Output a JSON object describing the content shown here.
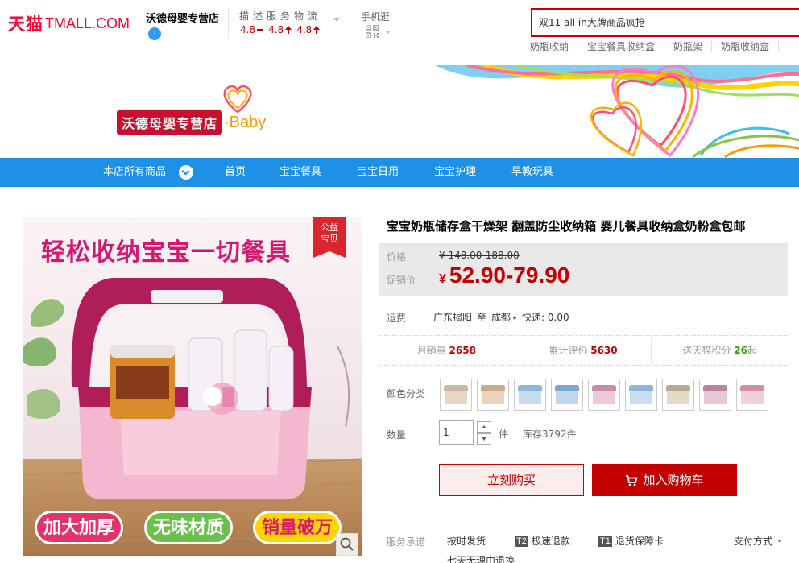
{
  "header": {
    "logo_cn": "天猫",
    "logo_en": "TMALL.COM",
    "shop_name": "沃德母婴专营店",
    "shop_badge": "1",
    "rating_title": "描述服务物流",
    "scores": [
      {
        "value": "4.8",
        "trend": "flat"
      },
      {
        "value": "4.8",
        "trend": "up"
      },
      {
        "value": "4.8",
        "trend": "up"
      }
    ],
    "mobile_label": "手机逛",
    "search_value": "双11 all in大牌商品疯抢",
    "hotwords": [
      "奶瓶收纳",
      "宝宝餐具收纳盒",
      "奶瓶架",
      "奶瓶收纳盒"
    ]
  },
  "banner": {
    "shop_logo_cn": "沃德母婴专营店",
    "shop_logo_en": "·Baby"
  },
  "nav": {
    "items": [
      "本店所有商品",
      "首页",
      "宝宝餐具",
      "宝宝日用",
      "宝宝护理",
      "早教玩具"
    ]
  },
  "gallery": {
    "headline": "轻松收纳宝宝一切餐具",
    "badge_line1": "公益",
    "badge_line2": "宝贝",
    "pills": [
      "加大加厚",
      "无味材质",
      "销量破万"
    ]
  },
  "product": {
    "title": "宝宝奶瓶储存盒干燥架 翻盖防尘收纳箱 婴儿餐具收纳盒奶粉盒包邮",
    "price_label": "价格",
    "original_price": "¥ 148.00-188.00",
    "promo_label": "促销价",
    "promo_currency": "¥",
    "promo_price": "52.90-79.90",
    "shipping_label": "运费",
    "ship_from": "广东揭阳",
    "ship_to_prefix": "至",
    "ship_to": "成都",
    "express": "快递: 0.00",
    "stats": {
      "monthly_sales_label": "月销量",
      "monthly_sales": "2658",
      "reviews_label": "累计评价",
      "reviews": "5630",
      "points_label": "送天猫积分",
      "points": "26",
      "points_suffix": "起"
    },
    "color_label": "颜色分类",
    "swatch_colors": [
      {
        "lid": "#c9b8a8",
        "body": "#e7d6c4"
      },
      {
        "lid": "#c7ab8e",
        "body": "#e9d3bb"
      },
      {
        "lid": "#8fb3d9",
        "body": "#c5dbf0"
      },
      {
        "lid": "#7fa7d3",
        "body": "#bfd6ee"
      },
      {
        "lid": "#c98aa7",
        "body": "#edc9da"
      },
      {
        "lid": "#8fb3d9",
        "body": "#c9def2"
      },
      {
        "lid": "#b8a792",
        "body": "#e4d8c8"
      },
      {
        "lid": "#b7859d",
        "body": "#e6c7d5"
      },
      {
        "lid": "#d28fab",
        "body": "#f2cfdd"
      }
    ],
    "qty_label": "数量",
    "qty_value": "1",
    "unit": "件",
    "stock": "库存3792件",
    "buy_now": "立刻购买",
    "add_to_cart": "加入购物车",
    "services_label": "服务承诺",
    "services": [
      {
        "badge": "",
        "text": "按时发货"
      },
      {
        "badge": "T2",
        "text": "极速退款"
      },
      {
        "badge": "T1",
        "text": "退货保障卡"
      }
    ],
    "services_second_line": "七天无理由退换",
    "payment": "支付方式"
  }
}
